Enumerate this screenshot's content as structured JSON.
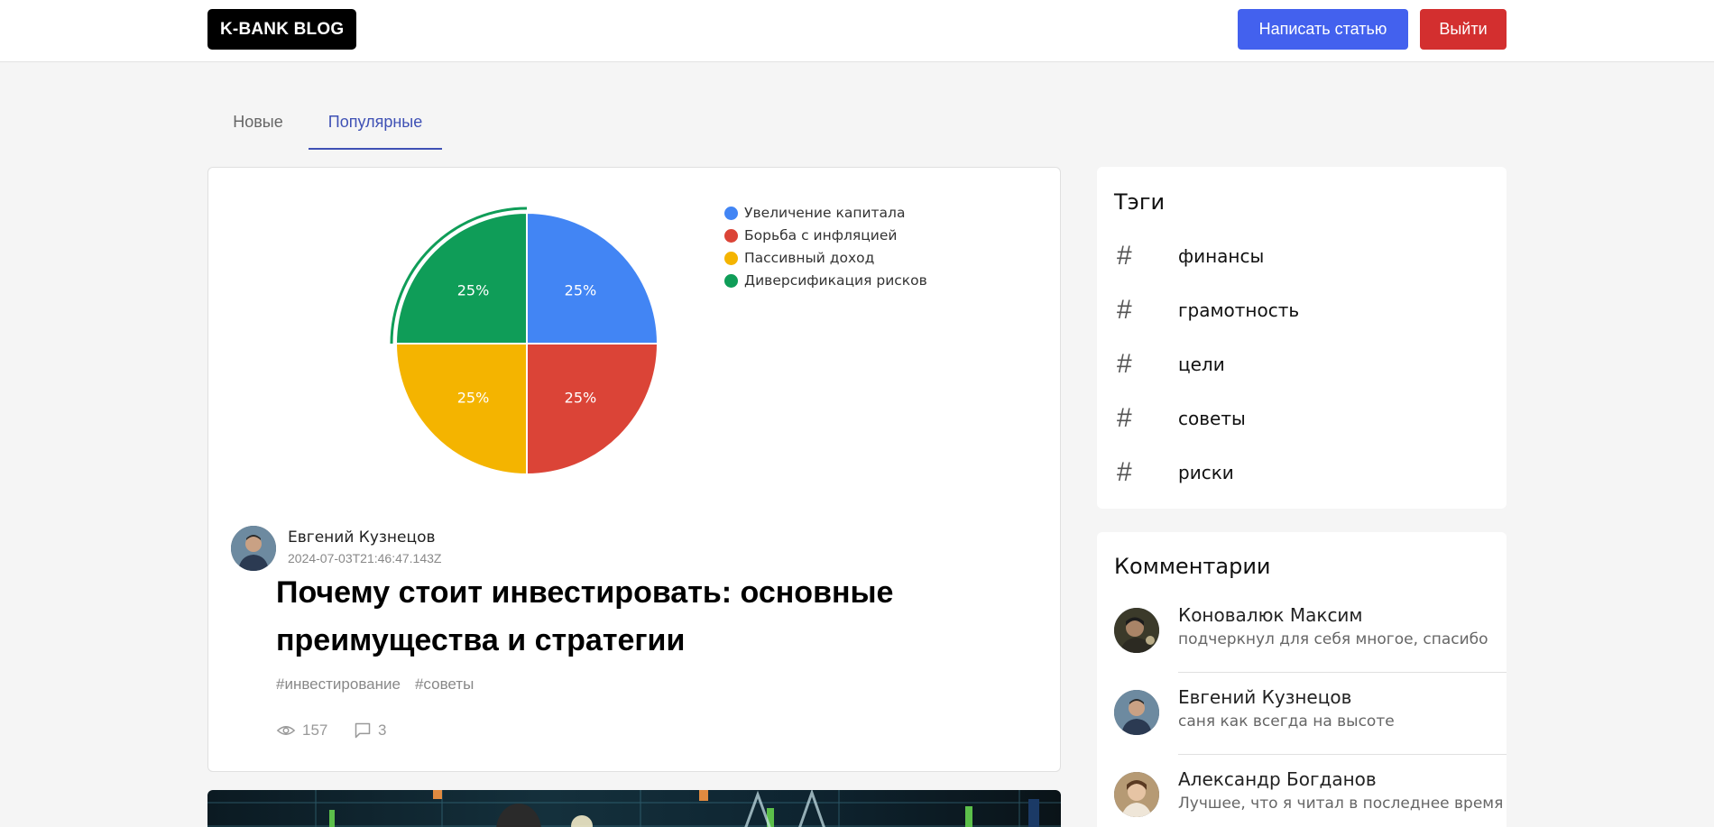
{
  "header": {
    "logo": "K-BANK BLOG",
    "write_button": "Написать статью",
    "logout_button": "Выйти",
    "colors": {
      "primary": "#4361ee",
      "danger": "#d32f2f"
    }
  },
  "tabs": [
    {
      "label": "Новые",
      "active": false
    },
    {
      "label": "Популярные",
      "active": true
    }
  ],
  "post": {
    "author": "Евгений Кузнецов",
    "date": "2024-07-03T21:46:47.143Z",
    "title": "Почему стоит инвестировать: основные преимущества и стратегии",
    "tags": [
      "#инвестирование",
      "#советы"
    ],
    "views": "157",
    "comments": "3"
  },
  "chart_data": {
    "type": "pie",
    "categories": [
      "Увеличение капитала",
      "Борьба с инфляцией",
      "Пассивный доход",
      "Диверсификация рисков"
    ],
    "values": [
      25,
      25,
      25,
      25
    ],
    "labels": [
      "25%",
      "25%",
      "25%",
      "25%"
    ],
    "colors": [
      "#4285f4",
      "#db4437",
      "#f4b400",
      "#0f9d58"
    ],
    "legend_position": "right",
    "highlighted": "Диверсификация рисков"
  },
  "sidebar": {
    "tags_title": "Тэги",
    "tags": [
      "финансы",
      "грамотность",
      "цели",
      "советы",
      "риски"
    ],
    "comments_title": "Комментарии",
    "comments": [
      {
        "name": "Коновалюк Максим",
        "text": "подчеркнул для себя многое, спасибо"
      },
      {
        "name": "Евгений Кузнецов",
        "text": "саня как всегда на высоте"
      },
      {
        "name": "Александр Богданов",
        "text": "Лучшее, что я читал в последнее время"
      }
    ]
  }
}
